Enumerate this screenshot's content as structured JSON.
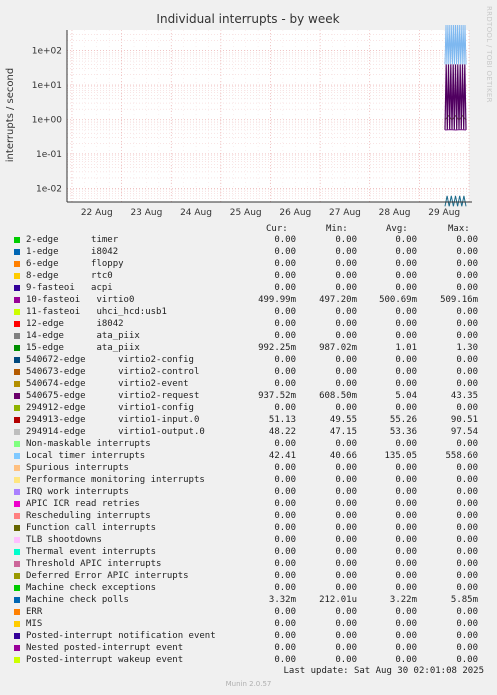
{
  "chart_data": {
    "type": "line",
    "title": "Individual interrupts - by week",
    "ylabel": "interrupts / second",
    "yscale": "log",
    "ylim": [
      0.004,
      400
    ],
    "y_ticks": [
      "1e+02",
      "1e+01",
      "1e+00",
      "1e-01",
      "1e-02"
    ],
    "x_ticks": [
      "22 Aug",
      "23 Aug",
      "24 Aug",
      "25 Aug",
      "26 Aug",
      "27 Aug",
      "28 Aug",
      "29 Aug"
    ],
    "grid": true,
    "series_plotted": [
      {
        "name": "Local timer interrupts",
        "color": "#7eb8f0",
        "range": [
          40,
          558
        ]
      },
      {
        "name": "15-edge",
        "color": "#6a8a2a",
        "range": [
          0.98,
          1.3
        ]
      },
      {
        "name": "540675-edge",
        "color": "#500060",
        "range": [
          0.5,
          40
        ]
      },
      {
        "name": "10-fasteoi",
        "color": "#7a1a8a",
        "range": [
          0.497,
          0.509
        ]
      },
      {
        "name": "Machine check polls",
        "color": "#1a6a8a",
        "range": [
          0.003,
          0.006
        ]
      }
    ]
  },
  "legend": {
    "headers": {
      "cur": "Cur:",
      "min": "Min:",
      "avg": "Avg:",
      "max": "Max:"
    },
    "rows": [
      {
        "label": "2-edge      timer",
        "color": "#00cc00",
        "cur": "0.00",
        "min": "0.00",
        "avg": "0.00",
        "max": "0.00"
      },
      {
        "label": "1-edge      i8042",
        "color": "#0066b3",
        "cur": "0.00",
        "min": "0.00",
        "avg": "0.00",
        "max": "0.00"
      },
      {
        "label": "6-edge      floppy",
        "color": "#ff8000",
        "cur": "0.00",
        "min": "0.00",
        "avg": "0.00",
        "max": "0.00"
      },
      {
        "label": "8-edge      rtc0",
        "color": "#ffcc00",
        "cur": "0.00",
        "min": "0.00",
        "avg": "0.00",
        "max": "0.00"
      },
      {
        "label": "9-fasteoi   acpi",
        "color": "#330099",
        "cur": "0.00",
        "min": "0.00",
        "avg": "0.00",
        "max": "0.00"
      },
      {
        "label": "10-fasteoi   virtio0",
        "color": "#990099",
        "cur": "499.99m",
        "min": "497.20m",
        "avg": "500.69m",
        "max": "509.16m"
      },
      {
        "label": "11-fasteoi   uhci_hcd:usb1",
        "color": "#ccff00",
        "cur": "0.00",
        "min": "0.00",
        "avg": "0.00",
        "max": "0.00"
      },
      {
        "label": "12-edge      i8042",
        "color": "#ff0000",
        "cur": "0.00",
        "min": "0.00",
        "avg": "0.00",
        "max": "0.00"
      },
      {
        "label": "14-edge      ata_piix",
        "color": "#808080",
        "cur": "0.00",
        "min": "0.00",
        "avg": "0.00",
        "max": "0.00"
      },
      {
        "label": "15-edge      ata_piix",
        "color": "#008f00",
        "cur": "992.25m",
        "min": "987.02m",
        "avg": "1.01",
        "max": "1.30"
      },
      {
        "label": "540672-edge      virtio2-config",
        "color": "#00487d",
        "cur": "0.00",
        "min": "0.00",
        "avg": "0.00",
        "max": "0.00"
      },
      {
        "label": "540673-edge      virtio2-control",
        "color": "#b35a00",
        "cur": "0.00",
        "min": "0.00",
        "avg": "0.00",
        "max": "0.00"
      },
      {
        "label": "540674-edge      virtio2-event",
        "color": "#b38f00",
        "cur": "0.00",
        "min": "0.00",
        "avg": "0.00",
        "max": "0.00"
      },
      {
        "label": "540675-edge      virtio2-request",
        "color": "#6b006b",
        "cur": "937.52m",
        "min": "608.50m",
        "avg": "5.04",
        "max": "43.35"
      },
      {
        "label": "294912-edge      virtio1-config",
        "color": "#8fb300",
        "cur": "0.00",
        "min": "0.00",
        "avg": "0.00",
        "max": "0.00"
      },
      {
        "label": "294913-edge      virtio1-input.0",
        "color": "#b30000",
        "cur": "51.13",
        "min": "49.55",
        "avg": "55.26",
        "max": "90.51"
      },
      {
        "label": "294914-edge      virtio1-output.0",
        "color": "#bebebe",
        "cur": "48.22",
        "min": "47.15",
        "avg": "53.36",
        "max": "97.54"
      },
      {
        "label": "Non-maskable interrupts",
        "color": "#80ff80",
        "cur": "0.00",
        "min": "0.00",
        "avg": "0.00",
        "max": "0.00"
      },
      {
        "label": "Local timer interrupts",
        "color": "#80c9ff",
        "cur": "42.41",
        "min": "40.66",
        "avg": "135.05",
        "max": "558.60"
      },
      {
        "label": "Spurious interrupts",
        "color": "#ffc080",
        "cur": "0.00",
        "min": "0.00",
        "avg": "0.00",
        "max": "0.00"
      },
      {
        "label": "Performance monitoring interrupts",
        "color": "#ffe680",
        "cur": "0.00",
        "min": "0.00",
        "avg": "0.00",
        "max": "0.00"
      },
      {
        "label": "IRQ work interrupts",
        "color": "#aa80ff",
        "cur": "0.00",
        "min": "0.00",
        "avg": "0.00",
        "max": "0.00"
      },
      {
        "label": "APIC ICR read retries",
        "color": "#ee00cc",
        "cur": "0.00",
        "min": "0.00",
        "avg": "0.00",
        "max": "0.00"
      },
      {
        "label": "Rescheduling interrupts",
        "color": "#ff8080",
        "cur": "0.00",
        "min": "0.00",
        "avg": "0.00",
        "max": "0.00"
      },
      {
        "label": "Function call interrupts",
        "color": "#666600",
        "cur": "0.00",
        "min": "0.00",
        "avg": "0.00",
        "max": "0.00"
      },
      {
        "label": "TLB shootdowns",
        "color": "#ffbfff",
        "cur": "0.00",
        "min": "0.00",
        "avg": "0.00",
        "max": "0.00"
      },
      {
        "label": "Thermal event interrupts",
        "color": "#00ffcc",
        "cur": "0.00",
        "min": "0.00",
        "avg": "0.00",
        "max": "0.00"
      },
      {
        "label": "Threshold APIC interrupts",
        "color": "#cc6699",
        "cur": "0.00",
        "min": "0.00",
        "avg": "0.00",
        "max": "0.00"
      },
      {
        "label": "Deferred Error APIC interrupts",
        "color": "#999900",
        "cur": "0.00",
        "min": "0.00",
        "avg": "0.00",
        "max": "0.00"
      },
      {
        "label": "Machine check exceptions",
        "color": "#00cc00",
        "cur": "0.00",
        "min": "0.00",
        "avg": "0.00",
        "max": "0.00"
      },
      {
        "label": "Machine check polls",
        "color": "#0066b3",
        "cur": "3.32m",
        "min": "212.01u",
        "avg": "3.22m",
        "max": "5.85m"
      },
      {
        "label": "ERR",
        "color": "#ff8000",
        "cur": "0.00",
        "min": "0.00",
        "avg": "0.00",
        "max": "0.00"
      },
      {
        "label": "MIS",
        "color": "#ffcc00",
        "cur": "0.00",
        "min": "0.00",
        "avg": "0.00",
        "max": "0.00"
      },
      {
        "label": "Posted-interrupt notification event",
        "color": "#330099",
        "cur": "0.00",
        "min": "0.00",
        "avg": "0.00",
        "max": "0.00"
      },
      {
        "label": "Nested posted-interrupt event",
        "color": "#990099",
        "cur": "0.00",
        "min": "0.00",
        "avg": "0.00",
        "max": "0.00"
      },
      {
        "label": "Posted-interrupt wakeup event",
        "color": "#ccff00",
        "cur": "0.00",
        "min": "0.00",
        "avg": "0.00",
        "max": "0.00"
      }
    ]
  },
  "last_update": "Last update: Sat Aug 30 02:01:08 2025",
  "footer": "Munin 2.0.57",
  "side_label": "RRDTOOL / TOBI OETIKER"
}
